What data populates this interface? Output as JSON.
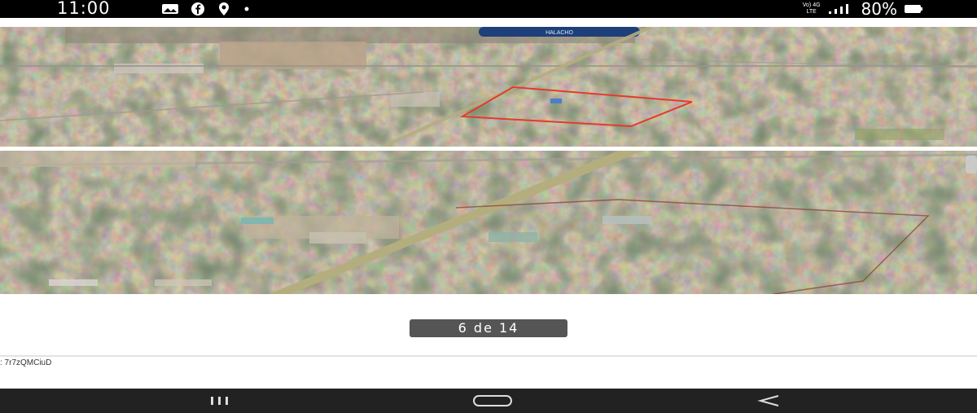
{
  "status_bar": {
    "time": "11:00",
    "network_top": "Vo) 4G",
    "network_bottom": "LTE",
    "battery": "80%",
    "icons": [
      "gallery-icon",
      "facebook-icon",
      "location-icon",
      "dot-icon",
      "signal-icon",
      "battery-icon"
    ]
  },
  "map": {
    "place_label": "HALACHO",
    "outline_color": "#e53a2a",
    "road_color": "#b4ae7f"
  },
  "gallery": {
    "counter": "6 de 14"
  },
  "footer": {
    "url_fragment": ": 7r7zQMCiuD"
  },
  "nav": {
    "icons": [
      "recent-apps-icon",
      "home-icon",
      "back-icon"
    ]
  }
}
